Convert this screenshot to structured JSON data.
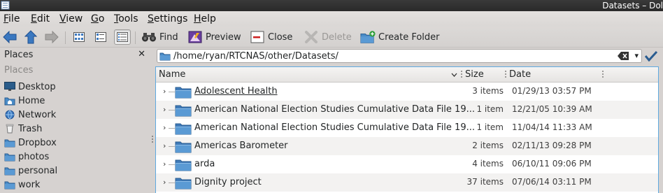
{
  "window": {
    "title": "Datasets – Dol"
  },
  "menu": {
    "items": [
      {
        "label": "File",
        "accel": "F",
        "rest": "ile"
      },
      {
        "label": "Edit",
        "accel": "E",
        "rest": "dit"
      },
      {
        "label": "View",
        "accel": "V",
        "rest": "iew"
      },
      {
        "label": "Go",
        "accel": "G",
        "rest": "o"
      },
      {
        "label": "Tools",
        "accel": "T",
        "rest": "ools"
      },
      {
        "label": "Settings",
        "accel": "S",
        "rest": "ettings"
      },
      {
        "label": "Help",
        "accel": "H",
        "rest": "elp"
      }
    ]
  },
  "toolbar": {
    "find_label": "Find",
    "preview_label": "Preview",
    "close_label": "Close",
    "delete_label": "Delete",
    "create_folder_label": "Create Folder"
  },
  "places": {
    "panel_title": "Places",
    "group_title": "Places",
    "items": [
      {
        "label": "Desktop",
        "icon": "desktop-icon"
      },
      {
        "label": "Home",
        "icon": "home-icon"
      },
      {
        "label": "Network",
        "icon": "network-icon"
      },
      {
        "label": "Trash",
        "icon": "trash-icon"
      },
      {
        "label": "Dropbox",
        "icon": "folder-icon"
      },
      {
        "label": "photos",
        "icon": "folder-icon"
      },
      {
        "label": "personal",
        "icon": "folder-icon"
      },
      {
        "label": "work",
        "icon": "folder-icon"
      }
    ]
  },
  "location": {
    "path": "/home/ryan/RTCNAS/other/Datasets/"
  },
  "fileview": {
    "columns": {
      "name": "Name",
      "size": "Size",
      "date": "Date"
    },
    "rows": [
      {
        "name": "Adolescent Health",
        "size": "3 items",
        "date": "01/29/13 03:57 PM",
        "hovered": true
      },
      {
        "name": "American National Election Studies Cumulative Data File 19...",
        "size": "1 item",
        "date": "12/21/05 10:39 AM"
      },
      {
        "name": "American National Election Studies Cumulative Data File 19...",
        "size": "1 item",
        "date": "11/04/14 11:33 AM"
      },
      {
        "name": "Americas Barometer",
        "size": "2 items",
        "date": "02/11/13 09:28 PM"
      },
      {
        "name": "arda",
        "size": "4 items",
        "date": "06/10/11 09:06 PM"
      },
      {
        "name": "Dignity project",
        "size": "37 items",
        "date": "07/06/14 03:11 PM"
      }
    ]
  },
  "colors": {
    "accent": "#3daee9",
    "folder": "#4a8cc7",
    "selection_border": "#5ea9e0"
  }
}
